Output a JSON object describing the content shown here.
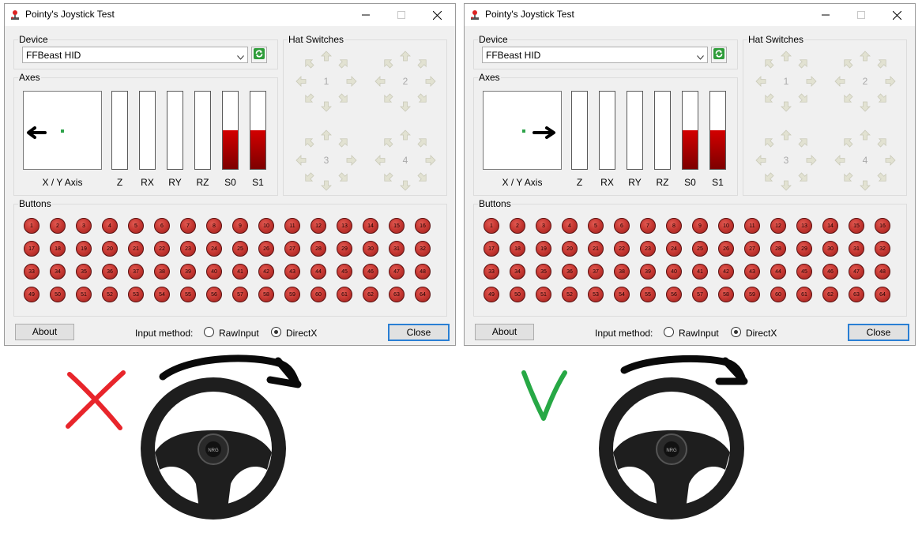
{
  "windows": [
    {
      "title": "Pointy's Joystick Test",
      "device_group_label": "Device",
      "device_value": "FFBeast HID",
      "axes_group_label": "Axes",
      "xy_axis_label": "X / Y Axis",
      "xy_position": {
        "x": -0.02,
        "y": 0.0
      },
      "xy_arrow": "left",
      "axes": [
        {
          "label": "Z",
          "level": 0
        },
        {
          "label": "RX",
          "level": 0
        },
        {
          "label": "RY",
          "level": 0
        },
        {
          "label": "RZ",
          "level": 0
        },
        {
          "label": "S0",
          "level": 0.5
        },
        {
          "label": "S1",
          "level": 0.5
        }
      ],
      "hat_group_label": "Hat Switches",
      "hats": [
        "1",
        "2",
        "3",
        "4"
      ],
      "buttons_group_label": "Buttons",
      "about_label": "About",
      "input_method_label": "Input method:",
      "rawinput_label": "RawInput",
      "directx_label": "DirectX",
      "selected_input_method": "DirectX",
      "close_label": "Close"
    },
    {
      "title": "Pointy's Joystick Test",
      "device_group_label": "Device",
      "device_value": "FFBeast HID",
      "axes_group_label": "Axes",
      "xy_axis_label": "X / Y Axis",
      "xy_position": {
        "x": 0.02,
        "y": 0.0
      },
      "xy_arrow": "right",
      "axes": [
        {
          "label": "Z",
          "level": 0
        },
        {
          "label": "RX",
          "level": 0
        },
        {
          "label": "RY",
          "level": 0
        },
        {
          "label": "RZ",
          "level": 0
        },
        {
          "label": "S0",
          "level": 0.5
        },
        {
          "label": "S1",
          "level": 0.5
        }
      ],
      "hat_group_label": "Hat Switches",
      "hats": [
        "1",
        "2",
        "3",
        "4"
      ],
      "buttons_group_label": "Buttons",
      "about_label": "About",
      "input_method_label": "Input method:",
      "rawinput_label": "RawInput",
      "directx_label": "DirectX",
      "selected_input_method": "DirectX",
      "close_label": "Close"
    }
  ],
  "button_count": 64,
  "annotations": [
    {
      "mark": "X",
      "meaning": "wrong",
      "color": "#e8252b",
      "rotation": "clockwise"
    },
    {
      "mark": "V",
      "meaning": "correct",
      "color": "#27a845",
      "rotation": "clockwise"
    }
  ],
  "colors": {
    "axis_fill": "#b30000",
    "button_red": "#c93a34",
    "xy_point": "#2ea34a",
    "close_border": "#2a7fd4",
    "refresh_green": "#2f9d3a"
  }
}
